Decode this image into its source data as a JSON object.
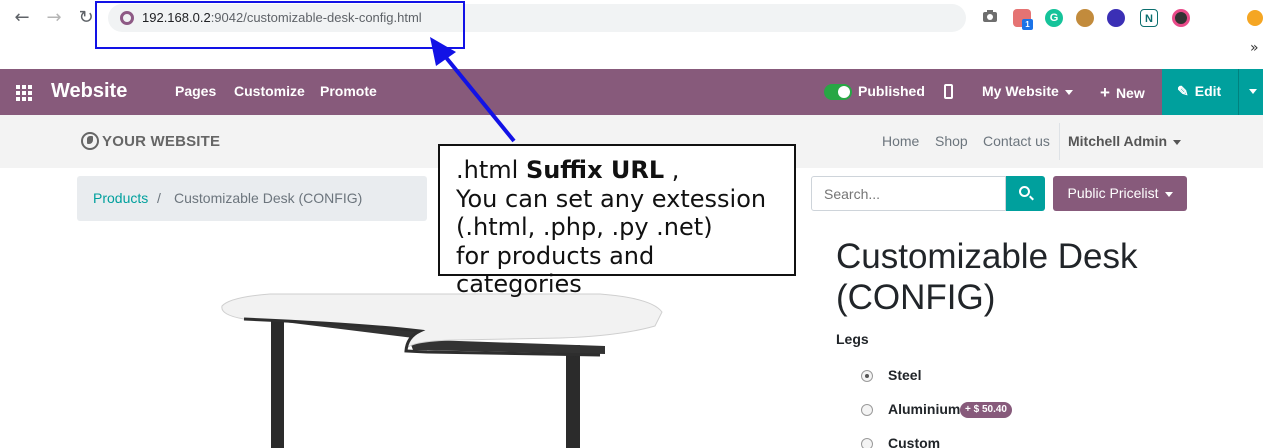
{
  "browser": {
    "url_host": "192.168.0.2",
    "url_rest": ":9042/customizable-desk-config.html",
    "extension_icons": [
      "camera-icon",
      "extension-puzzle-icon",
      "grammarly-icon",
      "spy-icon",
      "layers-icon",
      "notion-icon",
      "color-picker-icon"
    ],
    "extension_badge": "1"
  },
  "odoo_nav": {
    "app_name": "Website",
    "menu": [
      "Pages",
      "Customize",
      "Promote"
    ],
    "published_label": "Published",
    "website_selector": "My Website",
    "new_label": "New",
    "edit_label": "Edit"
  },
  "site_header": {
    "logo_text": "YOUR WEBSITE",
    "links": [
      "Home",
      "Shop",
      "Contact us"
    ],
    "user": "Mitchell Admin"
  },
  "breadcrumb": {
    "parent": "Products",
    "separator": "/",
    "current": "Customizable Desk (CONFIG)"
  },
  "search": {
    "placeholder": "Search..."
  },
  "pricelist": {
    "label": "Public Pricelist"
  },
  "product": {
    "title": "Customizable Desk (CONFIG)",
    "attribute_label": "Legs",
    "options": [
      {
        "label": "Steel",
        "selected": true,
        "extra": ""
      },
      {
        "label": "Aluminium",
        "selected": false,
        "extra": "+ $ 50.40"
      },
      {
        "label": "Custom",
        "selected": false,
        "extra": ""
      }
    ]
  },
  "annotation": {
    "line1_prefix": ".html ",
    "line1_bold": "Suffix URL",
    "line1_suffix": " ,",
    "line2": "You can set any extession",
    "line3": "(.html, .php, .py .net)",
    "line4": "for products and categories",
    "color": "#1212e6"
  },
  "colors": {
    "odoo_purple": "#875a7b",
    "odoo_teal": "#00a09d"
  }
}
